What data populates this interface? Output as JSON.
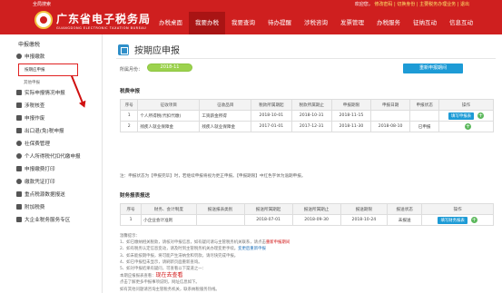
{
  "header": {
    "util_left": "全局搜索",
    "util_right_pre": "欢迎您，",
    "util_right_links": "修改密码 | 切换身份 | 主要税务办理业务 | 退出",
    "brand_cn": "广东省电子税务局",
    "brand_en": "GUANGDONG ELECTRONIC TAXATION BUREAU",
    "nav": [
      {
        "label": "办税桌面"
      },
      {
        "label": "我要办税"
      },
      {
        "label": "我要查询"
      },
      {
        "label": "待办提醒"
      },
      {
        "label": "涉税咨询"
      },
      {
        "label": "发票管理"
      },
      {
        "label": "办税服务"
      },
      {
        "label": "征纳互动"
      },
      {
        "label": "信息互动"
      }
    ]
  },
  "sidebar": {
    "title": "申报缴税",
    "items": [
      {
        "label": "申报缴款"
      },
      {
        "label": "按期应申报",
        "active": true
      },
      {
        "label": "其他申报"
      },
      {
        "label": "实际申报情况申报"
      },
      {
        "label": "涉税核查"
      },
      {
        "label": "申报作废"
      },
      {
        "label": "出口退(免)税申报"
      },
      {
        "label": "社保费管理"
      },
      {
        "label": "个人所得税代扣代缴申报"
      },
      {
        "label": "申报缴费打印"
      },
      {
        "label": "缴款凭证打印"
      },
      {
        "label": "重点税源数据报送"
      },
      {
        "label": "附加税费"
      },
      {
        "label": "大企业税务服务专区"
      }
    ]
  },
  "main": {
    "title": "按期应申报",
    "period_label": "所属月份：",
    "period_value": "2018-11",
    "refresh_button": "重新申报期间",
    "tax_section": "税费申报",
    "tax_headers": [
      "序号",
      "征收项目",
      "征收品目",
      "税款所属期起",
      "税款所属期止",
      "申报期限",
      "申报日期",
      "申报状态",
      "操作"
    ],
    "tax_rows": [
      {
        "no": "1",
        "item": "个人所得税(代扣代缴)",
        "sub": "工资薪金所得",
        "start": "2018-10-01",
        "end": "2018-10-31",
        "deadline": "2018-11-15",
        "date": "",
        "status": "",
        "action": "填写申报表"
      },
      {
        "no": "2",
        "item": "残疾人就业保障金",
        "sub": "残疾人就业保障金",
        "start": "2017-01-01",
        "end": "2017-12-31",
        "deadline": "2018-11-30",
        "date": "2018-08-10",
        "status": "已申报",
        "action": ""
      }
    ],
    "note": "注：申报状态为【申报完毕】时，若继续申报将视为更正申报。【申报期限】中红色字体为逾期申报。",
    "fin_section": "财务报表报送",
    "fin_headers": [
      "序号",
      "财务、会计制度",
      "报送报表类别",
      "报送所属期起",
      "报送所属期止",
      "报送期限",
      "报送状态",
      "操作"
    ],
    "fin_rows": [
      {
        "no": "1",
        "system": "小企业会计准则",
        "type": "",
        "start": "2018-07-01",
        "end": "2018-09-30",
        "deadline": "2018-10-24",
        "status": "未报送",
        "action": "填写财务报表"
      }
    ],
    "notes_title": "温馨提示：",
    "notes": [
      "1、如已缴纳相关税款，请核对申报信息，如有疑问请与主管税务机关联系，请点击",
      "2、如有税务认定信息变动，请及时到主管税务机关办理变更手续。",
      "3、如未能按期申报，将可能产生滞纳金和罚款，请尽快完成申报。",
      "4、如已申报但未显示，请刷新页面重新查询。",
      "5、如对申报结果有疑问，可查看以下渠道之一：",
      "   本期应报报表查看：",
      "   点击了解更多申报事项说明，网址信息如下。",
      "   如有其他问题请咨询主管税务机关，联系纳税服务热线。"
    ],
    "notes_link": "重新申报期间",
    "notes_big": "现在去查看",
    "notes_blue": "变更后重新申报"
  },
  "colors": {
    "brand_red": "#cf1f1f",
    "accent_blue": "#1d9bd6",
    "period_green": "#9cd24e"
  }
}
